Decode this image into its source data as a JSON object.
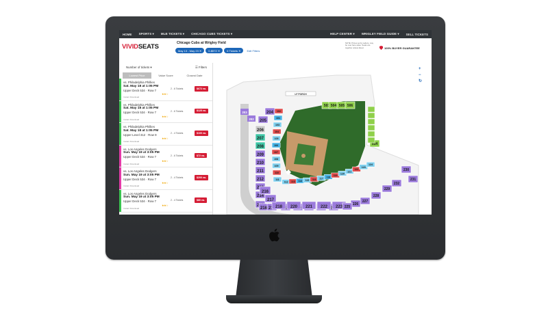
{
  "nav": {
    "left": [
      "HOME",
      "SPORTS ▾",
      "MLB TICKETS ▾",
      "CHICAGO CUBS TICKETS ▾"
    ],
    "right": [
      "HELP CENTER ▾",
      "WRIGLEY FIELD GUIDE ▾",
      "SELL TICKETS"
    ]
  },
  "header": {
    "logo_vivid": "VIVID",
    "logo_seats": "SEATS",
    "event": "Chicago Cubs at Wrigley Field",
    "chips": [
      "May 13 - May 23 ✕",
      "0-$572 ✕",
      "6 Tickets ✕"
    ],
    "edit_filters": "Edit Filters",
    "note": "NOTE: Prices set by sellers, may be over face value. Seats are together unless listed.",
    "guarantee": "100% BUYER GUARANTEE"
  },
  "controls": {
    "quantity": "Number of tickets ▾",
    "filters": "☰ Filters",
    "tabs": [
      "Lowest Price",
      "Value Score",
      "Closest Date"
    ],
    "active_tab": "Lowest Price"
  },
  "listings": [
    {
      "opp": "vs. Philadelphia Phillies",
      "date": "Sat. May 18 at 1:05 PM",
      "sec": "Upper Deck 534 · Row 7",
      "dl": "Instant Download",
      "tix": "2 - 6 Tickets",
      "price": "$672 ea.",
      "bar": "#39c24f",
      "stars": "★★☆"
    },
    {
      "opp": "vs. Philadelphia Phillies",
      "date": "Sat. May 18 at 1:05 PM",
      "sec": "Upper Deck 534 · Row 7",
      "dl": "Instant Download",
      "tix": "2 - 6 Tickets",
      "price": "$125 ea.",
      "bar": "#39c24f",
      "stars": "★★☆"
    },
    {
      "opp": "vs. Philadelphia Phillies",
      "date": "Sat. May 18 at 1:05 PM",
      "sec": "Upper Level 312 · Row 9",
      "dl": "Instant Download",
      "tix": "2 - 4 Tickets",
      "price": "$100 ea.",
      "bar": "#39c24f",
      "stars": "★★☆"
    },
    {
      "opp": "vs. Los Angeles Dodgers",
      "date": "Sun. May 19 at 3:05 PM",
      "sec": "Upper Deck 534 · Row 7",
      "dl": "Instant Download",
      "tix": "2 - 6 Tickets",
      "price": "$72 ea.",
      "bar": "#e23aa6",
      "stars": "★★☆"
    },
    {
      "opp": "vs. Los Angeles Dodgers",
      "date": "Sun. May 19 at 3:05 PM",
      "sec": "Upper Deck 534 · Row 7",
      "dl": "Instant Download",
      "tix": "2 - 4 Tickets",
      "price": "$200 ea.",
      "bar": "#e23aa6",
      "stars": "★★☆"
    },
    {
      "opp": "vs. Los Angeles Dodgers",
      "date": "Sun. May 19 at 3:05 PM",
      "sec": "Upper Deck 534 · Row 7",
      "dl": "Instant Download",
      "tix": "2 - 4 Tickets",
      "price": "$80 ea.",
      "bar": "#39c24f",
      "stars": "★★☆"
    }
  ],
  "map": {
    "field_color": "#2f6b2a",
    "upper_left_sections": [
      "204",
      "205",
      "206",
      "207",
      "208",
      "209",
      "210",
      "211",
      "212",
      "213",
      "214",
      "215",
      "216",
      "217",
      "218",
      "220",
      "221",
      "222",
      "223"
    ],
    "upper_right_sections": [
      "503",
      "504",
      "505",
      "506",
      "514",
      "230",
      "231",
      "232",
      "229",
      "228",
      "227",
      "226",
      "225"
    ],
    "lower_sections": [
      "102",
      "101",
      "103",
      "104",
      "105",
      "106",
      "107",
      "108",
      "109",
      "110",
      "111",
      "112",
      "113",
      "114",
      "115",
      "116",
      "117",
      "118",
      "119",
      "120",
      "121",
      "122",
      "123",
      "124"
    ],
    "left_top_sections": [
      "203",
      "202"
    ],
    "right_top_labels": [
      "LF PORCH"
    ],
    "zoom_in": "+",
    "zoom_out": "−",
    "reset": "↻"
  }
}
